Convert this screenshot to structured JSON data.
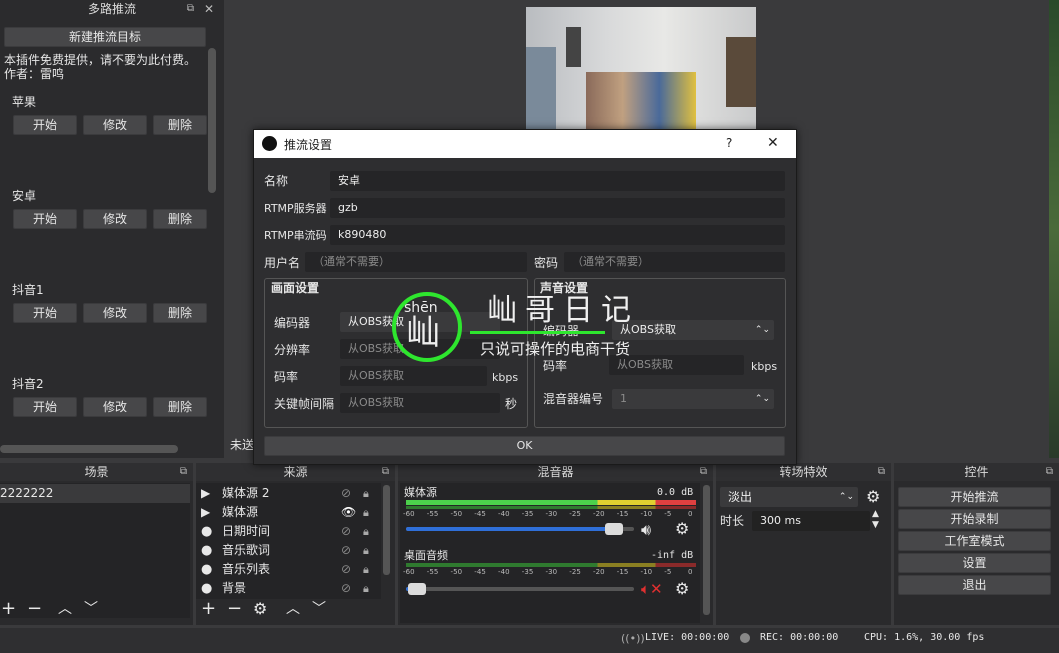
{
  "dock": {
    "title": "多路推流",
    "new_button": "新建推流目标",
    "notice_line1": "本插件免费提供，请不要为此付费。",
    "notice_line2": "作者：雷鸣",
    "targets": [
      {
        "name": "苹果"
      },
      {
        "name": "安卓"
      },
      {
        "name": "抖音1"
      },
      {
        "name": "抖音2"
      }
    ],
    "start_label": "开始",
    "edit_label": "修改",
    "delete_label": "删除",
    "status_partial": "未送"
  },
  "dialog": {
    "title": "推流设置",
    "help": "?",
    "close": "✕",
    "name_label": "名称",
    "name_value": "安卓",
    "server_label": "RTMP服务器",
    "server_value": "gzb",
    "key_label": "RTMP串流码",
    "key_value": "k890480",
    "user_label": "用户名",
    "user_placeholder": "（通常不需要）",
    "pass_label": "密码",
    "pass_placeholder": "（通常不需要）",
    "video_group": "画面设置",
    "encoder_label": "编码器",
    "encoder_value": "从OBS获取",
    "resolution_label": "分辨率",
    "resolution_value": "从OBS获取",
    "bitrate_label": "码率",
    "bitrate_value": "从OBS获取",
    "kbps": "kbps",
    "keyframe_label": "关键帧间隔",
    "keyframe_value": "从OBS获取",
    "sec": "秒",
    "audio_group": "声音设置",
    "aenc_label": "编码器",
    "aenc_value": "从OBS获取",
    "abitrate_label": "码率",
    "abitrate_value": "从OBS获取",
    "mixer_label": "混音器编号",
    "mixer_value": "1",
    "ok": "OK"
  },
  "watermark": {
    "pinyin": "shēn",
    "char": "屾",
    "title": "屾哥日记",
    "subtitle": "只说可操作的电商干货"
  },
  "scenes": {
    "title": "场景",
    "item": "2222222"
  },
  "sources": {
    "title": "来源",
    "items": [
      {
        "name": "媒体源 2",
        "icon": "play"
      },
      {
        "name": "媒体源",
        "icon": "play"
      },
      {
        "name": "日期时间",
        "icon": "globe"
      },
      {
        "name": "音乐歌词",
        "icon": "globe"
      },
      {
        "name": "音乐列表",
        "icon": "globe"
      },
      {
        "name": "背景",
        "icon": "globe"
      }
    ]
  },
  "mixer": {
    "title": "混音器",
    "ch1_name": "媒体源",
    "ch1_db": "0.0 dB",
    "ch2_name": "桌面音频",
    "ch2_db": "-inf dB",
    "ch1_volume": 0.95,
    "ch2_volume": 0.05,
    "ticks": [
      "-60",
      "-55",
      "-50",
      "-45",
      "-40",
      "-35",
      "-30",
      "-25",
      "-20",
      "-15",
      "-10",
      "-5",
      "0"
    ]
  },
  "transitions": {
    "title": "转场特效",
    "selected": "淡出",
    "duration_label": "时长",
    "duration_value": "300 ms"
  },
  "controls": {
    "title": "控件",
    "buttons": [
      "开始推流",
      "开始录制",
      "工作室模式",
      "设置",
      "退出"
    ]
  },
  "status": {
    "live": "LIVE: 00:00:00",
    "rec": "REC: 00:00:00",
    "cpu": "CPU: 1.6%, 30.00 fps"
  },
  "colors": {
    "green": "#4cd14c",
    "yellow": "#e0d030",
    "red": "#e04040",
    "accent": "#2f6fd8",
    "watermark": "#2ee62e"
  }
}
